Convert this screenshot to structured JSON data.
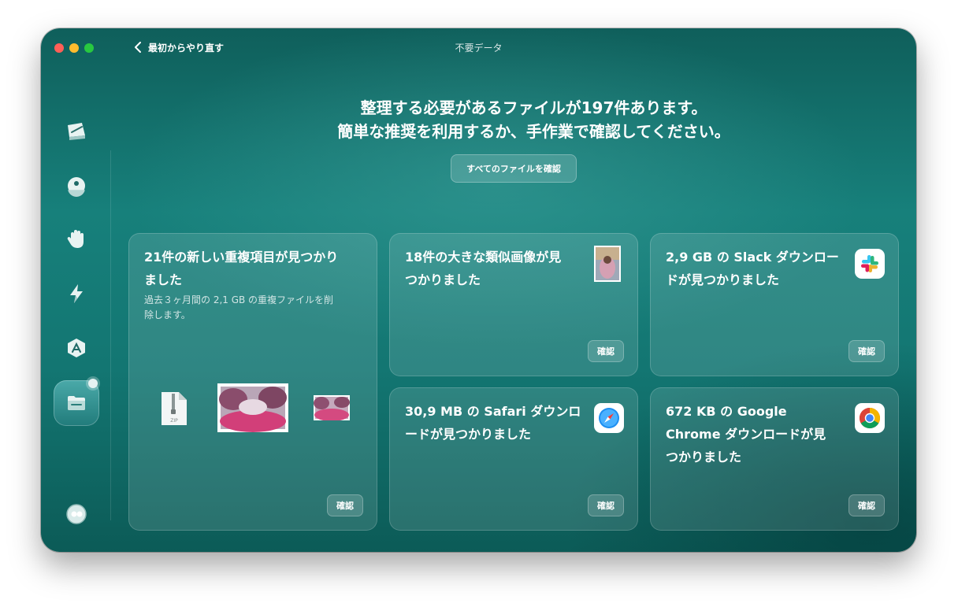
{
  "window": {
    "title": "不要データ",
    "back_label": "最初からやり直す"
  },
  "header": {
    "line1": "整理する必要があるファイルが197件あります。",
    "line2": "簡単な推奨を利用するか、手作業で確認してください。",
    "review_all_label": "すべてのファイルを確認"
  },
  "sidebar": {
    "items": [
      {
        "icon": "disk-icon"
      },
      {
        "icon": "shield-icon"
      },
      {
        "icon": "hand-icon"
      },
      {
        "icon": "lightning-icon"
      },
      {
        "icon": "applications-icon"
      },
      {
        "icon": "folder-icon",
        "active": true
      }
    ],
    "bottom_icon": "assistant-icon"
  },
  "cards": {
    "duplicates": {
      "title_line1": "21件の新しい重複項目が見つかり",
      "title_line2": "ました",
      "desc_line1": "過去３ヶ月間の 2,1 GB の重複ファイルを削",
      "desc_line2": "除します。",
      "zip_label": "ZIP",
      "button": "確認"
    },
    "similar_images": {
      "title_line1": "18件の大きな類似画像が見",
      "title_line2": "つかりました",
      "button": "確認"
    },
    "slack": {
      "title_line1": "2,9 GB の Slack ダウンロー",
      "title_line2": "ドが見つかりました",
      "icon": "slack-icon",
      "button": "確認"
    },
    "safari": {
      "title_line1": "30,9 MB の Safari ダウンロ",
      "title_line2": "ードが見つかりました",
      "icon": "safari-icon",
      "button": "確認"
    },
    "chrome": {
      "title_line1": "672 KB の Google",
      "title_line2": "Chrome ダウンロードが見",
      "title_line3": "つかりました",
      "icon": "chrome-icon",
      "button": "確認"
    }
  }
}
